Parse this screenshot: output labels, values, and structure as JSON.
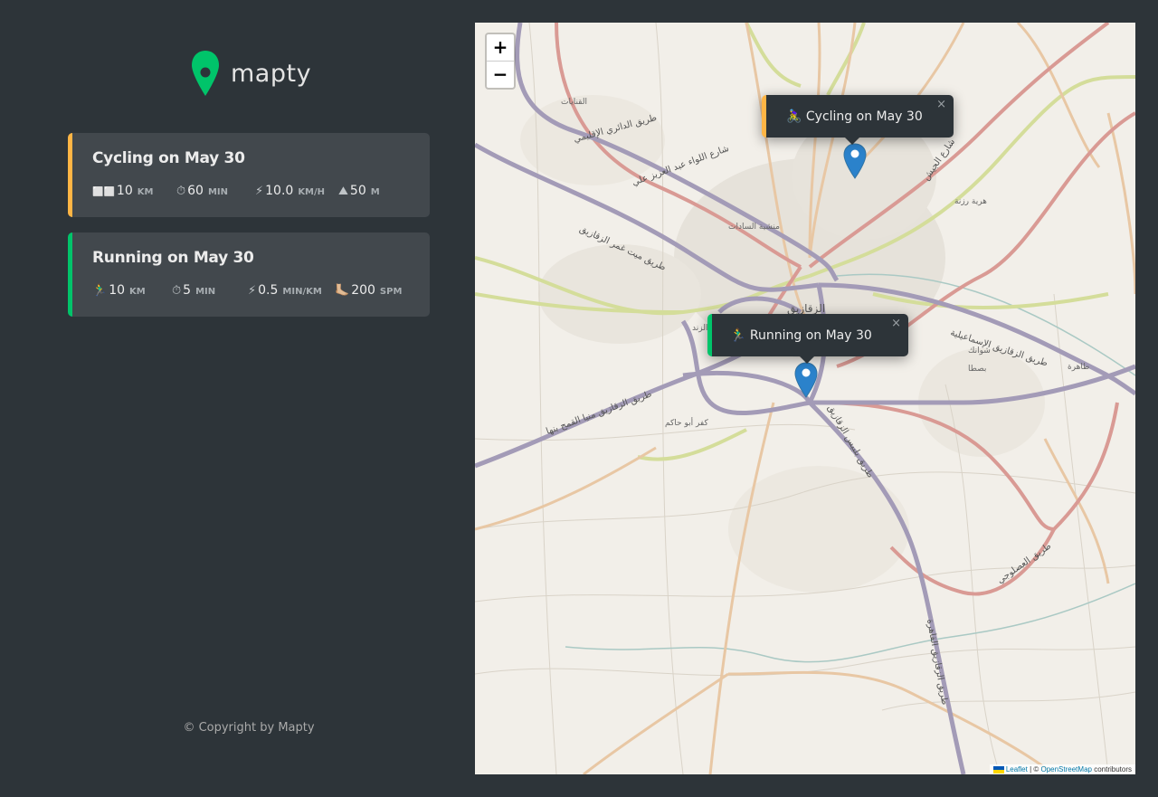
{
  "app": {
    "name": "mapty",
    "copyright": "© Copyright by Mapty",
    "colors": {
      "brand": "#00c46a",
      "cycling": "#ffb545",
      "running": "#00c46a",
      "background": "#2d3439",
      "card": "#42484d"
    }
  },
  "workouts": [
    {
      "type": "cycling",
      "title": "Cycling on May 30",
      "details": [
        {
          "icon": "⬜⬜",
          "icon_name": "bicycle-icon",
          "value": "10",
          "unit": "km"
        },
        {
          "icon": "⏱",
          "icon_name": "stopwatch-icon",
          "value": "60",
          "unit": "min"
        },
        {
          "icon": "⚡",
          "icon_name": "lightning-icon",
          "value": "10.0",
          "unit": "km/h"
        },
        {
          "icon": "⛰",
          "icon_name": "mountain-icon",
          "value": "50",
          "unit": "m"
        }
      ]
    },
    {
      "type": "running",
      "title": "Running on May 30",
      "details": [
        {
          "icon": "🏃‍♂️",
          "icon_name": "runner-icon",
          "value": "10",
          "unit": "km"
        },
        {
          "icon": "⏱",
          "icon_name": "stopwatch-icon",
          "value": "5",
          "unit": "min"
        },
        {
          "icon": "⚡",
          "icon_name": "lightning-icon",
          "value": "0.5",
          "unit": "min/km"
        },
        {
          "icon": "🦶🏼",
          "icon_name": "footprint-icon",
          "value": "200",
          "unit": "spm"
        }
      ]
    }
  ],
  "map": {
    "zoom_in_label": "+",
    "zoom_out_label": "−",
    "popups": [
      {
        "type": "cycling",
        "text": "🚴‍♀️ Cycling on May 30",
        "close": "×"
      },
      {
        "type": "running",
        "text": "🏃‍♂️ Running on May 30",
        "close": "×"
      }
    ],
    "place_labels": [
      "القنايات",
      "منشية السادات",
      "الزقازيق",
      "هرية رزنة",
      "شوانك",
      "بصطا",
      "طاهرة",
      "كفر أبو حاكم",
      "الزند"
    ],
    "road_labels": [
      "طريق الدائري الإقليمي",
      "شارع اللواء عبد العزيز علي",
      "طريق ميت غمر الزقازيق",
      "طريق الزقازيق الإسماعيلية",
      "طريق الزقازيق منيا القمح بنها",
      "طريق بلبيس الزقازيق",
      "طريق الزقازيق القاهرة",
      "طريق العصلوجي",
      "شارع الجيش"
    ],
    "attribution": {
      "leaflet": "Leaflet",
      "separator": " | © ",
      "osm": "OpenStreetMap",
      "suffix": " contributors"
    }
  }
}
